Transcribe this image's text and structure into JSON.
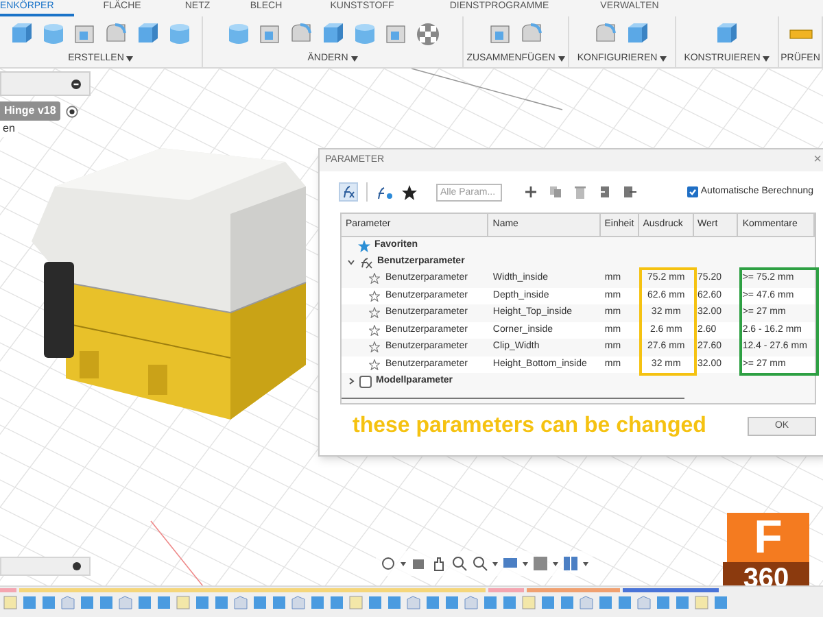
{
  "toolbar": {
    "tabs": [
      {
        "label": "ENKÖRPER",
        "selected": true
      },
      {
        "label": "FLÄCHE",
        "selected": false
      },
      {
        "label": "NETZ",
        "selected": false
      },
      {
        "label": "BLECH",
        "selected": false
      },
      {
        "label": "KUNSTSTOFF",
        "selected": false
      },
      {
        "label": "DIENSTPROGRAMME",
        "selected": false
      },
      {
        "label": "VERWALTEN",
        "selected": false
      }
    ],
    "groups": [
      {
        "label": "ERSTELLEN"
      },
      {
        "label": "ÄNDERN"
      },
      {
        "label": "ZUSAMMENFÜGEN"
      },
      {
        "label": "KONFIGURIEREN"
      },
      {
        "label": "KONSTRUIEREN"
      },
      {
        "label": "PRÜFEN"
      }
    ]
  },
  "browser": {
    "document": "Hinge v18",
    "item": "en"
  },
  "dialog": {
    "title": "PARAMETER",
    "close": "×",
    "search": {
      "placeholder": "Alle Param..."
    },
    "auto_calc": {
      "label": "Automatische Berechnung",
      "checked": true
    },
    "columns": [
      {
        "label": "Parameter"
      },
      {
        "label": "Name"
      },
      {
        "label": "Einheit"
      },
      {
        "label": "Ausdruck",
        "color": "#f5c211"
      },
      {
        "label": "Wert"
      },
      {
        "label": "Kommentare",
        "color": "#2ea043"
      }
    ],
    "groups": [
      {
        "kind": "favorites",
        "label": "Favoriten"
      },
      {
        "kind": "user",
        "label": "Benutzerparameter",
        "expanded": true,
        "rows": [
          {
            "type": "Benutzerparameter",
            "name": "Width_inside",
            "unit": "mm",
            "expression": "75.2 mm",
            "value": "75.20",
            "comment": ">= 75.2 mm",
            "favorite": false
          },
          {
            "type": "Benutzerparameter",
            "name": "Depth_inside",
            "unit": "mm",
            "expression": "62.6 mm",
            "value": "62.60",
            "comment": ">= 47.6 mm",
            "favorite": false
          },
          {
            "type": "Benutzerparameter",
            "name": "Height_Top_inside",
            "unit": "mm",
            "expression": "32 mm",
            "value": "32.00",
            "comment": ">= 27 mm",
            "favorite": false
          },
          {
            "type": "Benutzerparameter",
            "name": "Corner_inside",
            "unit": "mm",
            "expression": "2.6 mm",
            "value": "2.60",
            "comment": "2.6 - 16.2 mm",
            "favorite": false
          },
          {
            "type": "Benutzerparameter",
            "name": "Clip_Width",
            "unit": "mm",
            "expression": "27.6 mm",
            "value": "27.60",
            "comment": "12.4 - 27.6 mm",
            "favorite": false
          },
          {
            "type": "Benutzerparameter",
            "name": "Height_Bottom_inside",
            "unit": "mm",
            "expression": "32 mm",
            "value": "32.00",
            "comment": ">= 27 mm",
            "favorite": false
          }
        ]
      },
      {
        "kind": "model",
        "label": "Modellparameter",
        "expanded": false
      }
    ],
    "annotation": "these parameters can be changed",
    "ok": "OK"
  },
  "logo": {
    "letter": "F",
    "caption": "360"
  }
}
